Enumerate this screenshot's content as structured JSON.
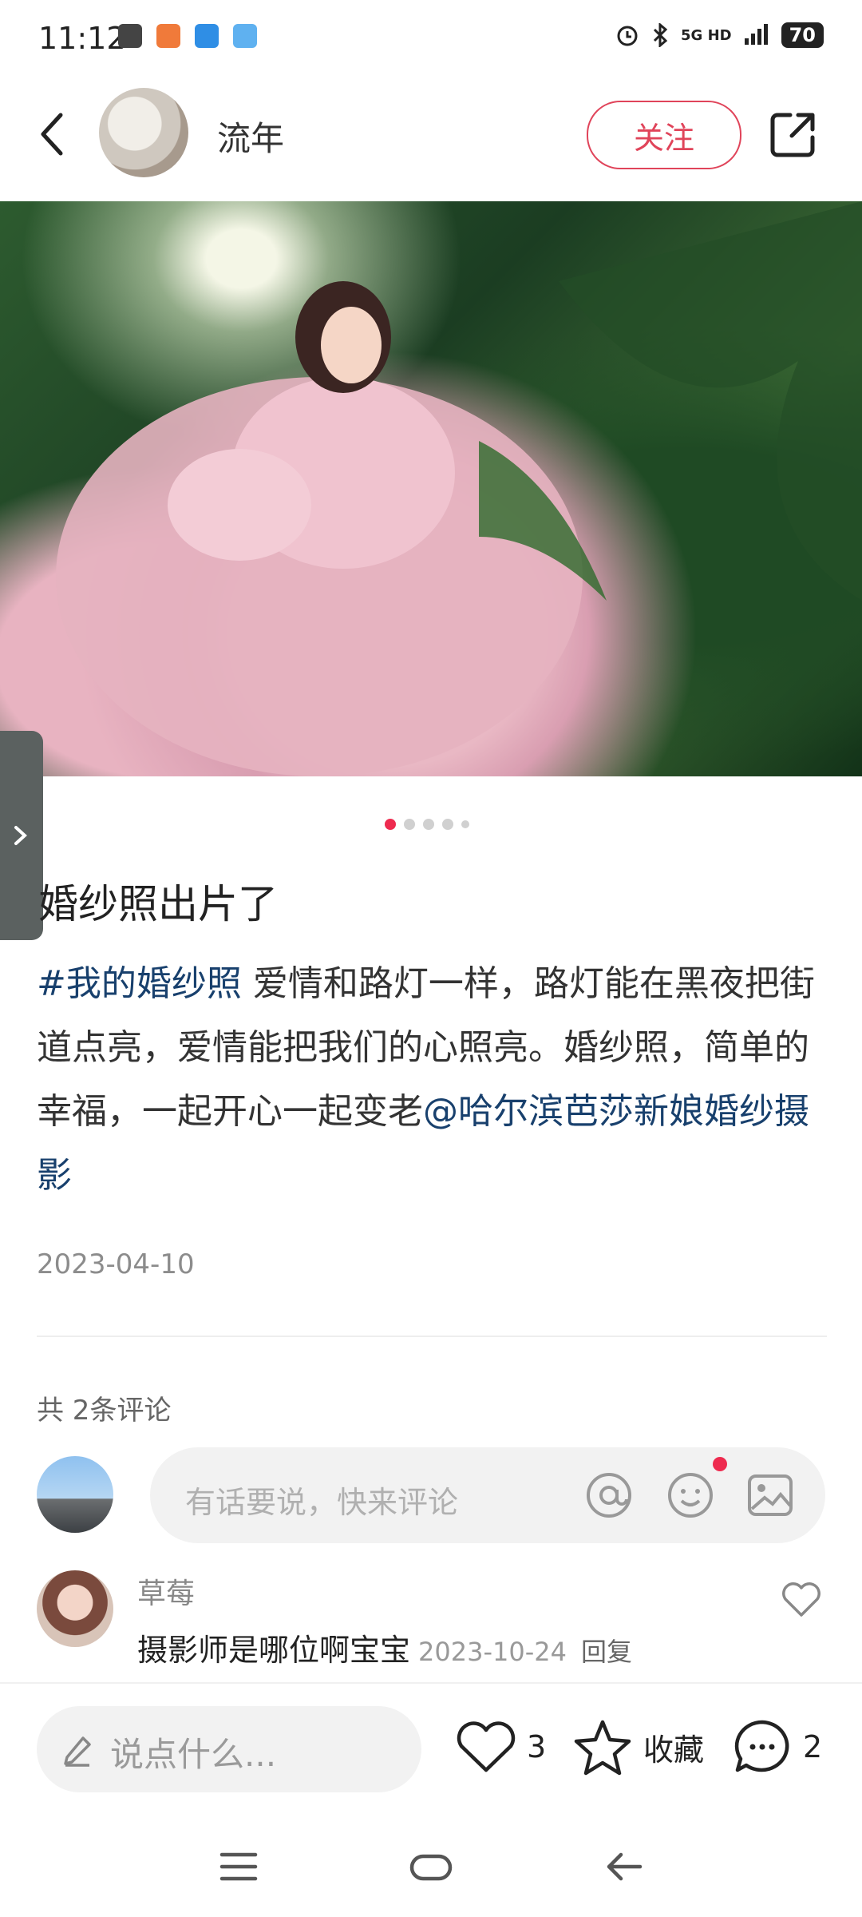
{
  "status_bar": {
    "time": "11:12",
    "network": "5G HD",
    "battery": "70"
  },
  "header": {
    "author_name": "流年",
    "follow_label": "关注"
  },
  "carousel": {
    "total": 5,
    "active_index": 0
  },
  "post": {
    "title": "婚纱照出片了",
    "hashtag": "#我的婚纱照",
    "body_text": " 爱情和路灯一样，路灯能在黑夜把街道点亮，爱情能把我们的心照亮。婚纱照，简单的幸福，一起开心一起变老",
    "mention": "@哈尔滨芭莎新娘婚纱摄影",
    "date": "2023-04-10"
  },
  "comments": {
    "count_label": "共 2条评论",
    "input_placeholder": "有话要说，快来评论",
    "items": [
      {
        "name": "草莓",
        "text": "摄影师是哪位啊宝宝",
        "date": "2023-10-24",
        "reply_label": "回复"
      }
    ]
  },
  "bottom_bar": {
    "say_placeholder": "说点什么...",
    "likes": "3",
    "favorite_label": "收藏",
    "comment_count": "2"
  },
  "colors": {
    "accent": "#e0445a",
    "link": "#18406d",
    "dot_active": "#ee2b4f"
  }
}
